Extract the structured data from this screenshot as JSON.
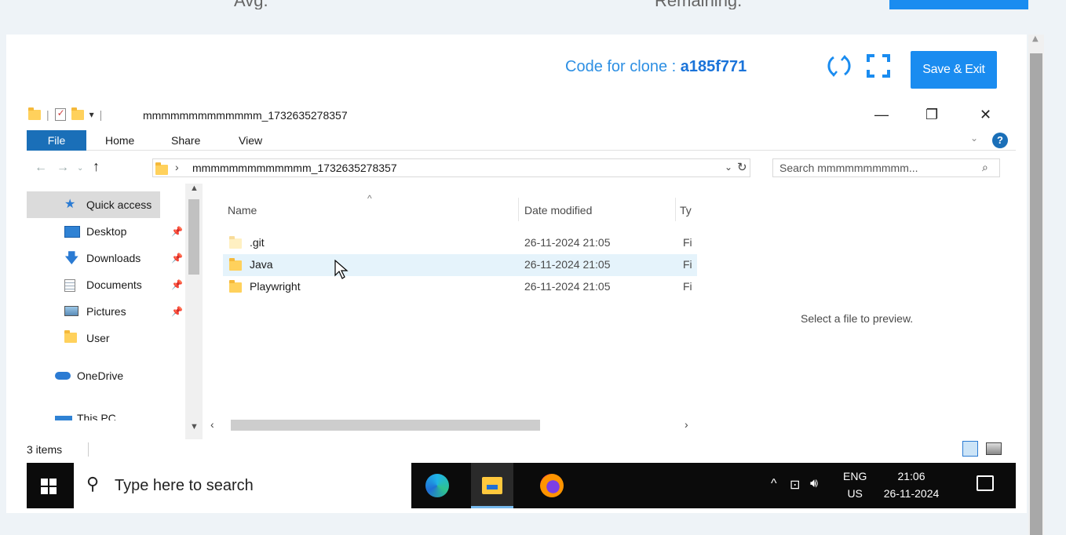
{
  "header_cut": {
    "avg_label": "Avg.",
    "remaining_label": "Remaining."
  },
  "toolbar": {
    "clone_prefix": "Code for clone : ",
    "clone_code": "a185f771",
    "save_label": "Save & Exit",
    "accent": "#1a8cf0"
  },
  "explorer": {
    "title": "mmmmmmmmmmmmm_1732635278357",
    "window_buttons": {
      "minimize": "—",
      "maximize": "❐",
      "close": "✕"
    },
    "ribbon": {
      "file": "File",
      "home": "Home",
      "share": "Share",
      "view": "View",
      "help": "?"
    },
    "address_path": "mmmmmmmmmmmmm_1732635278357",
    "search_placeholder": "Search mmmmmmmmmm...",
    "nav_items": [
      {
        "label": "Quick access",
        "icon": "star-icon"
      },
      {
        "label": "Desktop",
        "icon": "desktop-icon"
      },
      {
        "label": "Downloads",
        "icon": "download-icon"
      },
      {
        "label": "Documents",
        "icon": "documents-icon"
      },
      {
        "label": "Pictures",
        "icon": "pictures-icon"
      },
      {
        "label": "User",
        "icon": "folder-icon"
      },
      {
        "label": "OneDrive",
        "icon": "cloud-icon"
      },
      {
        "label": "This PC",
        "icon": "pc-icon"
      }
    ],
    "columns": {
      "name": "Name",
      "date": "Date modified",
      "type": "Ty"
    },
    "files": [
      {
        "name": ".git",
        "date": "26-11-2024 21:05",
        "type": "Fi"
      },
      {
        "name": "Java",
        "date": "26-11-2024 21:05",
        "type": "Fi"
      },
      {
        "name": "Playwright",
        "date": "26-11-2024 21:05",
        "type": "Fi"
      }
    ],
    "preview_message": "Select a file to preview.",
    "status_count": "3 items"
  },
  "taskbar": {
    "search_placeholder": "Type here to search",
    "apps": [
      "edge-icon",
      "file-explorer-icon",
      "firefox-icon"
    ],
    "lang_top": "ENG",
    "lang_bottom": "US",
    "time": "21:06",
    "date": "26-11-2024"
  }
}
